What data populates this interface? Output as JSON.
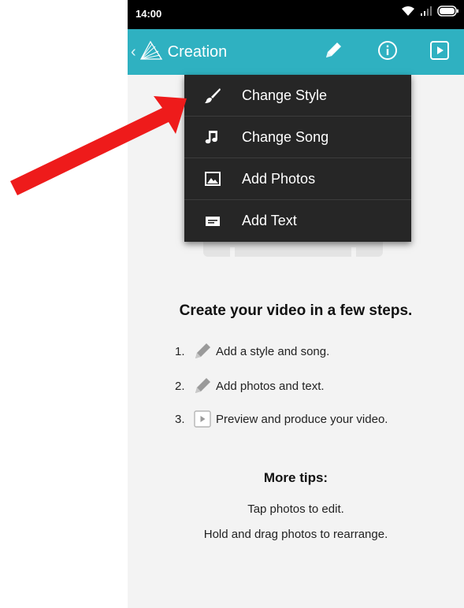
{
  "status_bar": {
    "time": "14:00"
  },
  "app_bar": {
    "title": "Creation"
  },
  "menu": {
    "items": [
      {
        "label": "Change Style",
        "icon": "brush-icon"
      },
      {
        "label": "Change Song",
        "icon": "music-note-icon"
      },
      {
        "label": "Add Photos",
        "icon": "image-icon"
      },
      {
        "label": "Add Text",
        "icon": "text-icon"
      }
    ]
  },
  "content": {
    "heading": "Create your video in a few steps.",
    "steps": [
      {
        "number": "1.",
        "icon": "pencil-icon",
        "text": "Add a style and song."
      },
      {
        "number": "2.",
        "icon": "pencil-icon",
        "text": "Add photos and text."
      },
      {
        "number": "3.",
        "icon": "play-icon",
        "text": "Preview and produce your video."
      }
    ],
    "tips_heading": "More tips:",
    "tips": [
      "Tap photos to edit.",
      "Hold and drag photos to rearrange."
    ]
  },
  "colors": {
    "app_bar": "#2fb1c1",
    "menu_bg": "#262626",
    "annotation_arrow": "#ee1b1b"
  }
}
